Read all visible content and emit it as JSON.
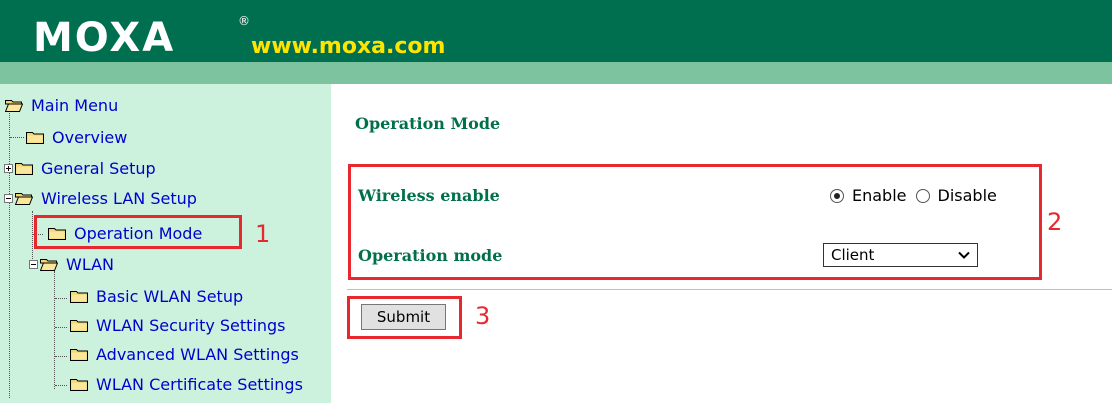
{
  "header": {
    "logo_text": "MOXA",
    "logo_reg": "®",
    "url_text": "www.moxa.com"
  },
  "sidebar": {
    "items": [
      {
        "label": "Main Menu",
        "icon": "folder-open-icon"
      },
      {
        "label": "Overview",
        "icon": "folder-icon"
      },
      {
        "label": "General Setup",
        "icon": "folder-icon",
        "expander": "+"
      },
      {
        "label": "Wireless LAN Setup",
        "icon": "folder-open-icon",
        "expander": "-"
      },
      {
        "label": "Operation Mode",
        "icon": "folder-icon"
      },
      {
        "label": "WLAN",
        "icon": "folder-open-icon",
        "expander": "-"
      },
      {
        "label": "Basic WLAN Setup",
        "icon": "folder-icon"
      },
      {
        "label": "WLAN Security Settings",
        "icon": "folder-icon"
      },
      {
        "label": "Advanced WLAN Settings",
        "icon": "folder-icon"
      },
      {
        "label": "WLAN Certificate Settings",
        "icon": "folder-icon"
      }
    ]
  },
  "main": {
    "title": "Operation Mode",
    "wireless_enable": {
      "label": "Wireless enable",
      "options": [
        "Enable",
        "Disable"
      ],
      "selected": "Enable"
    },
    "operation_mode": {
      "label": "Operation mode",
      "value": "Client"
    },
    "submit_label": "Submit"
  },
  "annotations": {
    "step1": "1",
    "step2": "2",
    "step3": "3",
    "color": "#e8282f"
  },
  "colors": {
    "header_bg": "#006f4f",
    "header_strip": "#7ec3a0",
    "sidebar_bg": "#ccf2dd",
    "label_green": "#00704a",
    "link_blue": "#0000cc",
    "url_yellow": "#ffe400"
  }
}
